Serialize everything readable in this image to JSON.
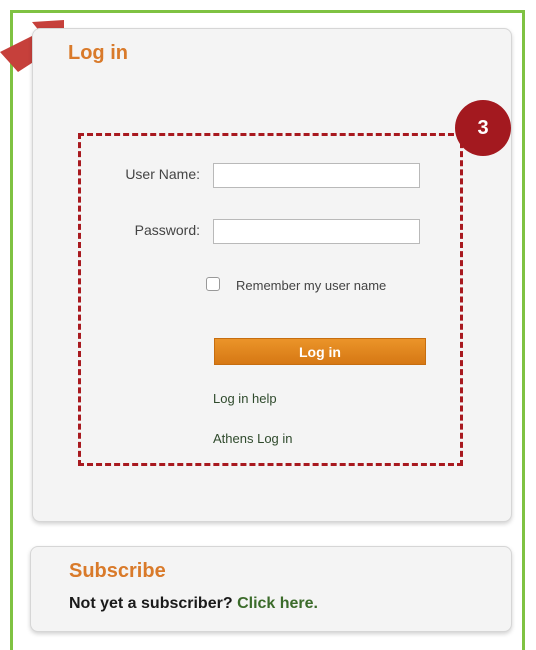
{
  "login": {
    "title": "Log in",
    "badge": "3",
    "username_label": "User Name:",
    "password_label": "Password:",
    "username_value": "",
    "password_value": "",
    "remember_label": "Remember my user name",
    "remember_checked": false,
    "submit_label": "Log in",
    "help_link": "Log in help",
    "athens_link": "Athens Log in"
  },
  "subscribe": {
    "title": "Subscribe",
    "text": "Not yet a subscriber?",
    "link": "Click here."
  },
  "colors": {
    "frame": "#7fc242",
    "accent": "#d97a2a",
    "dashed_highlight": "#a8191f",
    "button": "#e08a22"
  },
  "icons": {
    "arrow": "pointer-arrow-icon"
  }
}
